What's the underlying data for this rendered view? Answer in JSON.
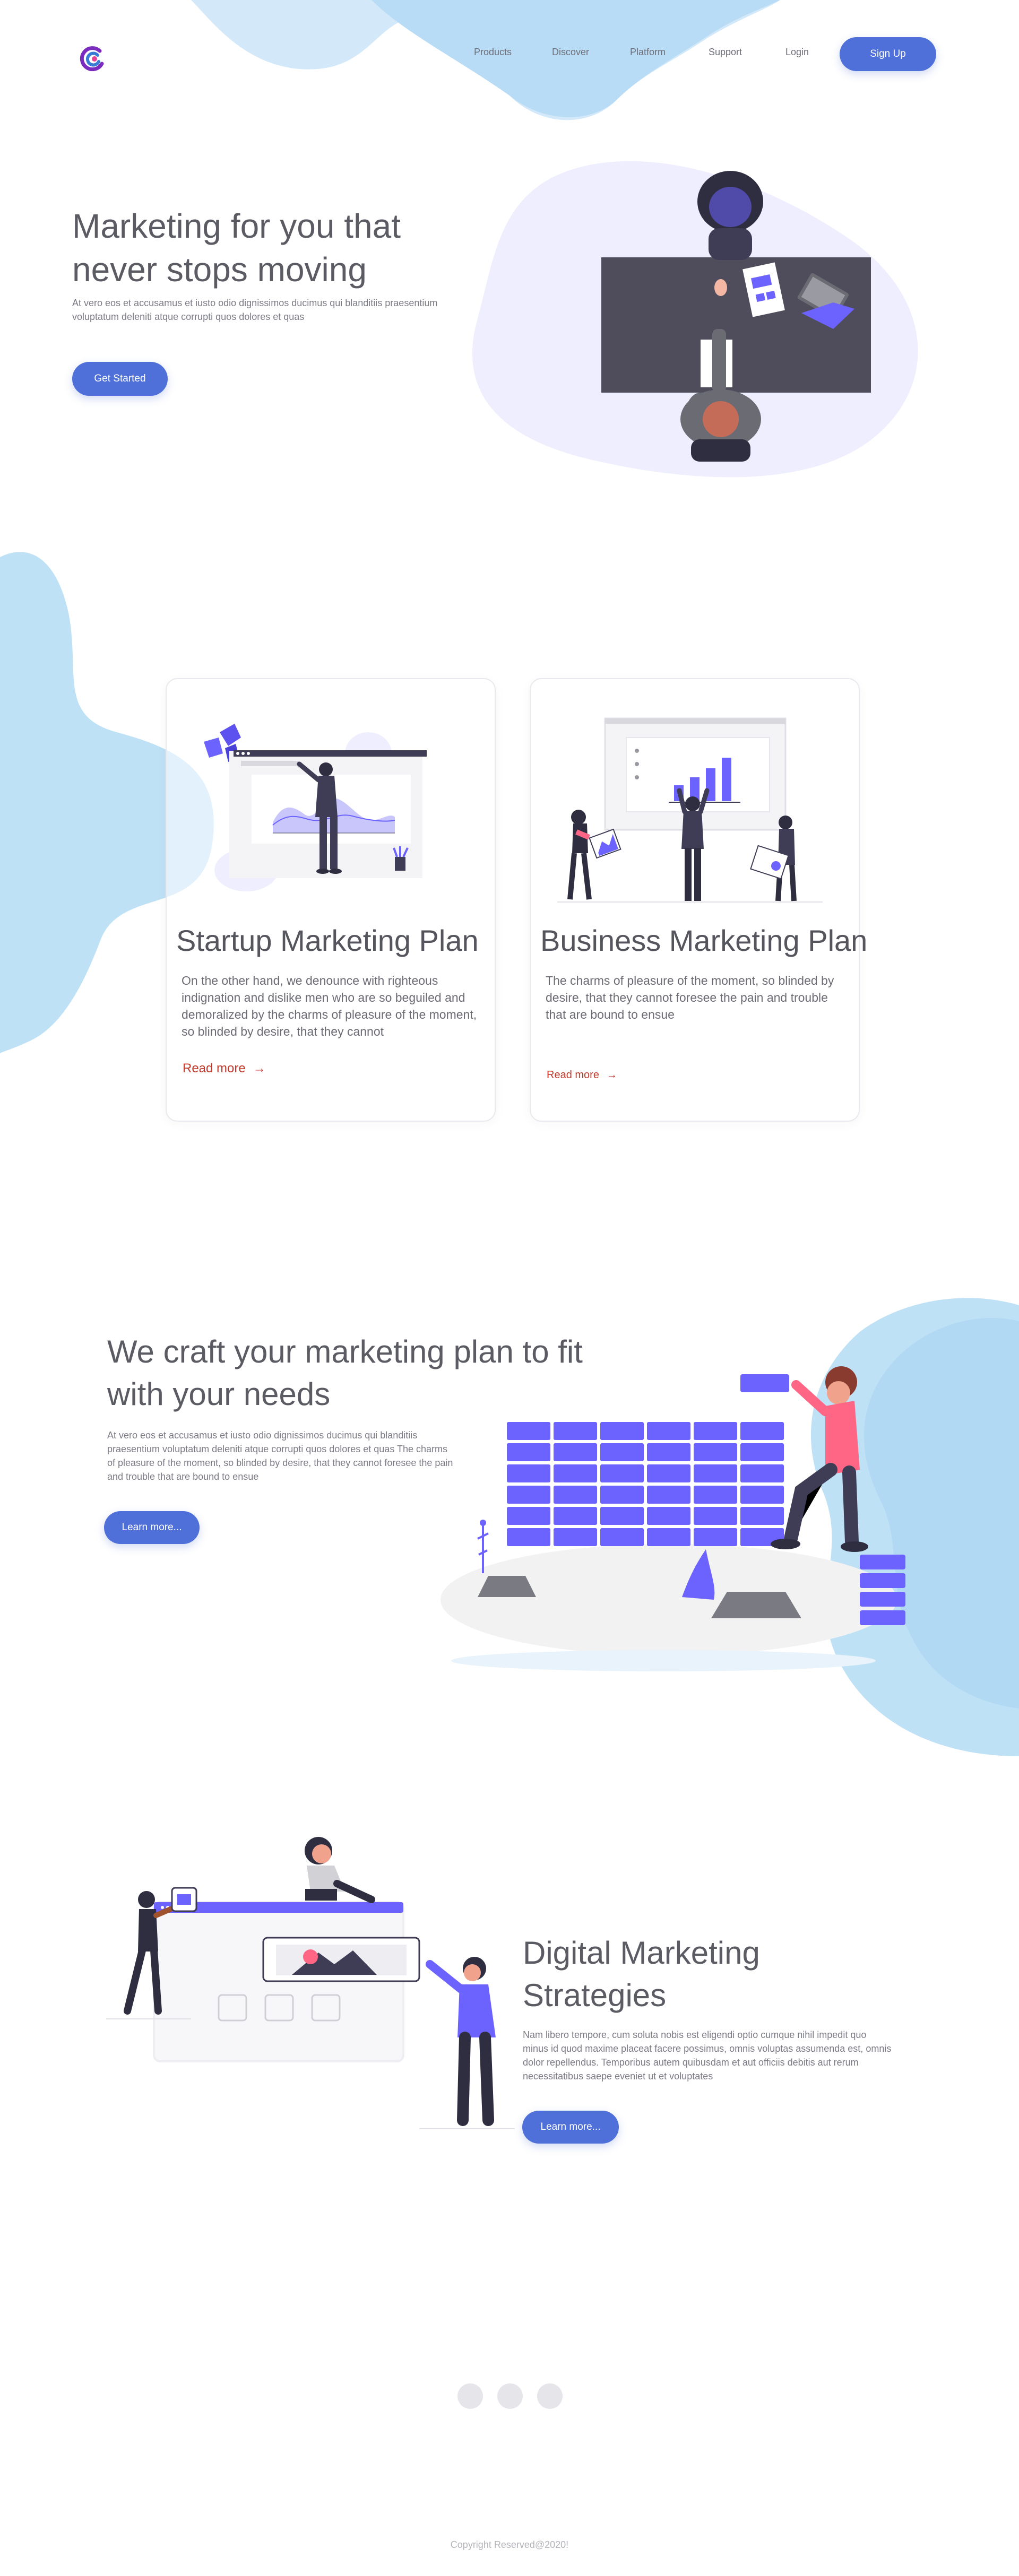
{
  "nav": {
    "logo_icon": "brand-logo-icon",
    "links": [
      "Products",
      "Discover",
      "Platform",
      "Support",
      "Login"
    ],
    "signup": "Sign Up"
  },
  "hero": {
    "title": "Marketing for you that never stops moving",
    "text": "At vero eos et accusamus et iusto odio dignissimos ducimus qui blanditiis praesentium voluptatum deleniti atque corrupti quos dolores et quas",
    "button": "Get Started"
  },
  "cards": [
    {
      "title": "Startup Marketing Plan",
      "text": "On the other hand, we denounce with righteous indignation and dislike men who are so beguiled and demoralized by the charms of pleasure of the moment, so blinded by desire, that they cannot",
      "link": "Read more"
    },
    {
      "title": "Business Marketing Plan",
      "text": "The charms of pleasure of the moment, so blinded by desire, that they cannot foresee the pain and trouble that are bound to ensue",
      "link": "Read more"
    }
  ],
  "craft": {
    "title": "We craft your marketing plan to fit with your needs",
    "text": "At vero eos et accusamus et iusto odio dignissimos ducimus qui blanditiis praesentium voluptatum deleniti atque corrupti quos dolores et quas The charms of pleasure of the moment, so blinded by desire, that they cannot foresee the pain and trouble that are bound to ensue",
    "button": "Learn more..."
  },
  "digital": {
    "title": "Digital Marketing Strategies",
    "text": "Nam libero tempore, cum soluta nobis est eligendi optio cumque nihil impedit quo minus id quod maxime placeat facere possimus, omnis voluptas assumenda est, omnis dolor repellendus. Temporibus autem quibusdam et aut officiis debitis aut rerum necessitatibus saepe eveniet ut et voluptates",
    "button": "Learn more..."
  },
  "footer": {
    "copyright": "Copyright Reserved@2020!"
  },
  "colors": {
    "accent": "#4f6fd9",
    "purple": "#6c63ff",
    "blob_blue": "#bfe1f6",
    "blob_lavender": "#efeefe",
    "link_red": "#c0392b",
    "dark": "#3f3d56"
  }
}
